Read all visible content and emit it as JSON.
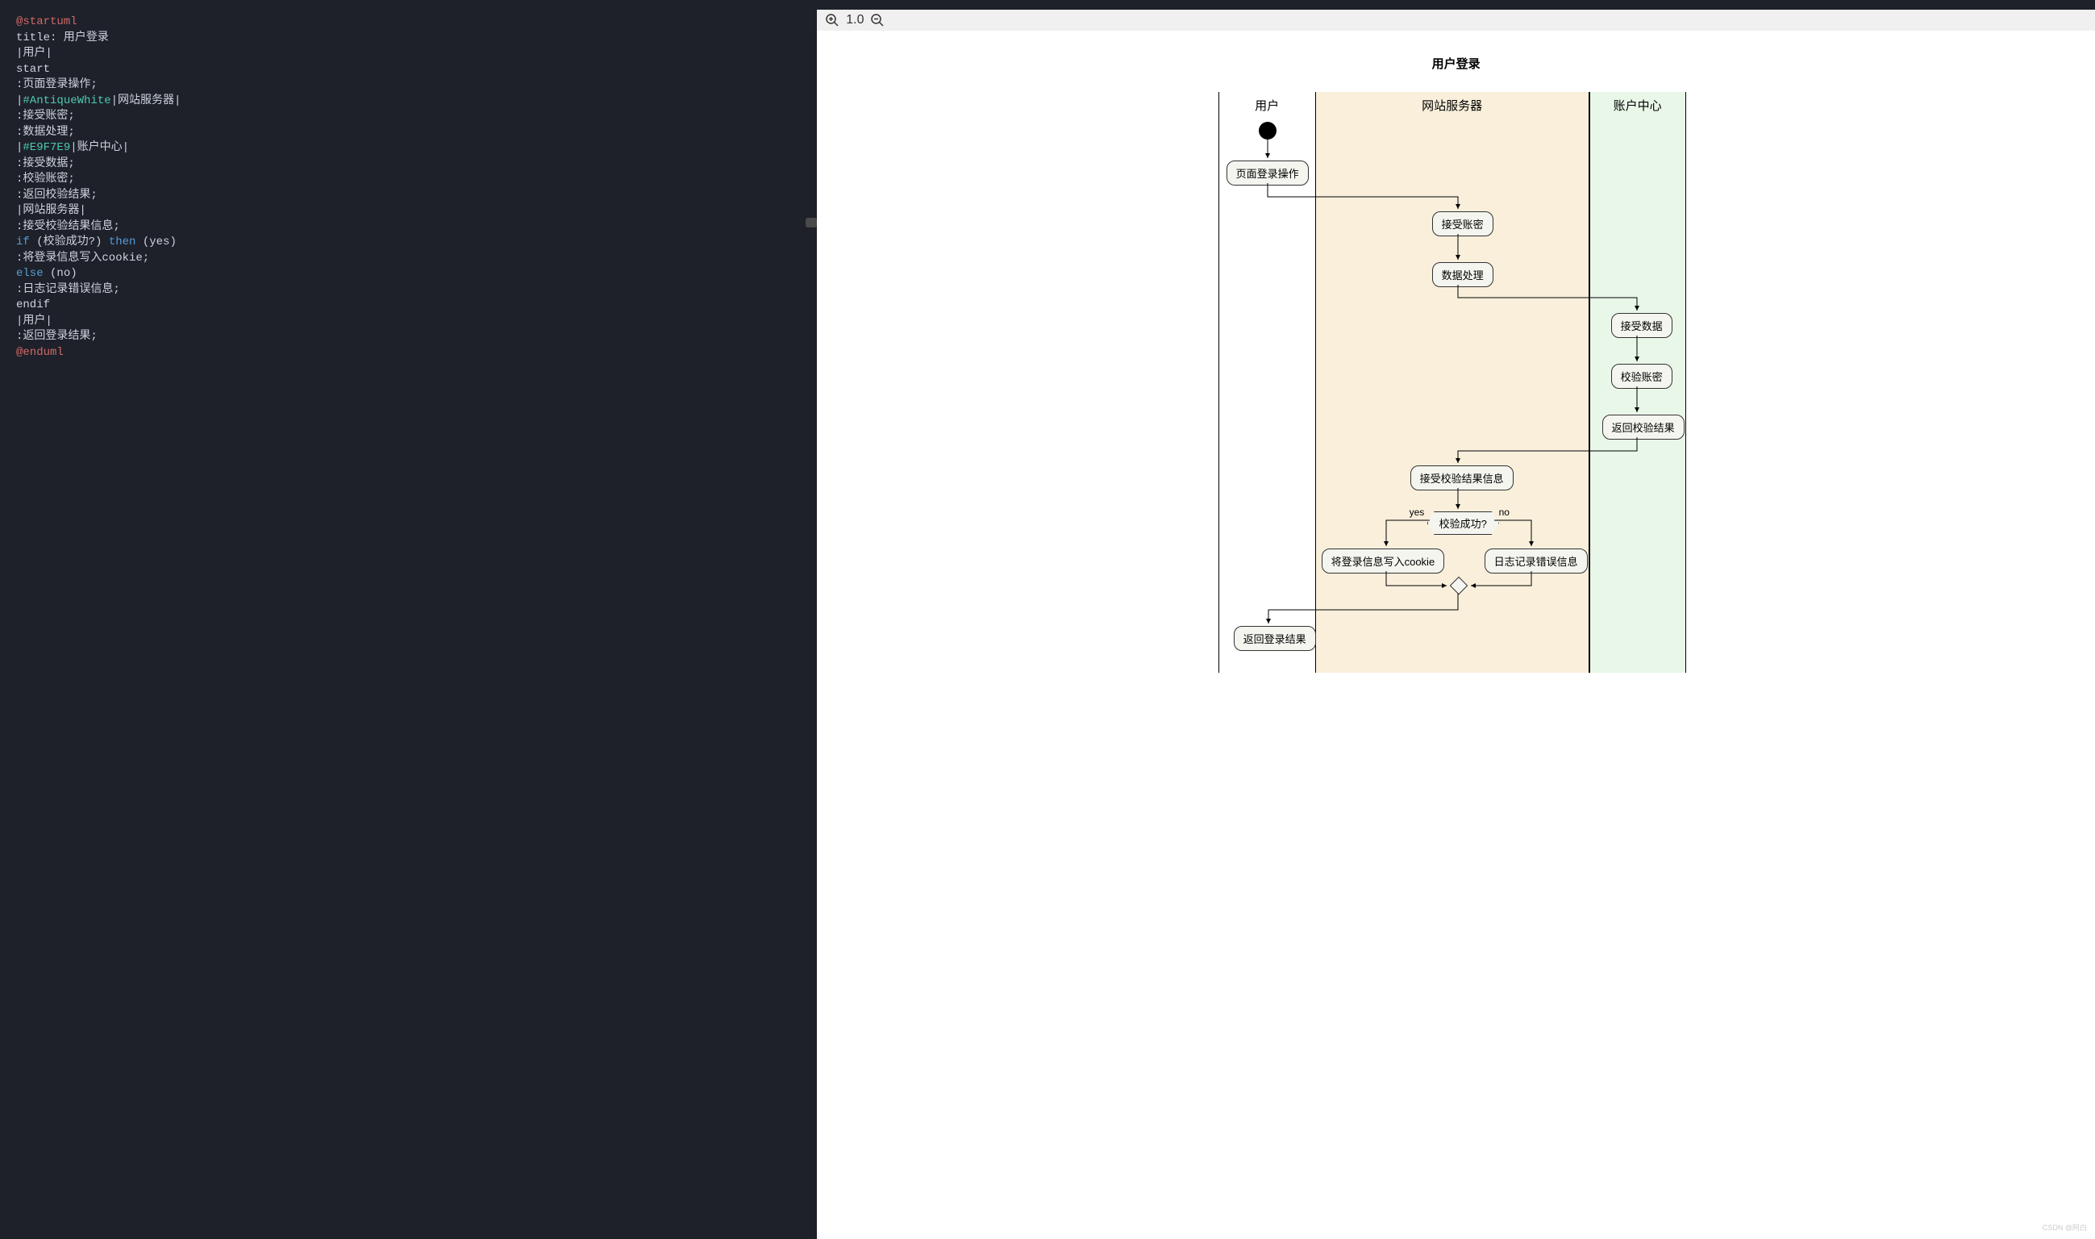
{
  "editor": {
    "lines": [
      {
        "tokens": [
          {
            "cls": "kw-red",
            "t": "@startuml"
          }
        ]
      },
      {
        "tokens": [
          {
            "cls": "txt",
            "t": "title: 用户登录"
          }
        ]
      },
      {
        "tokens": [
          {
            "cls": "txt",
            "t": "|用户|"
          }
        ]
      },
      {
        "tokens": [
          {
            "cls": "txt",
            "t": "start"
          }
        ]
      },
      {
        "tokens": [
          {
            "cls": "txt",
            "t": ":页面登录操作;"
          }
        ]
      },
      {
        "tokens": [
          {
            "cls": "txt",
            "t": "|"
          },
          {
            "cls": "kw-cyan",
            "t": "#AntiqueWhite"
          },
          {
            "cls": "txt",
            "t": "|网站服务器|"
          }
        ]
      },
      {
        "tokens": [
          {
            "cls": "txt",
            "t": ":接受账密;"
          }
        ]
      },
      {
        "tokens": [
          {
            "cls": "txt",
            "t": ":数据处理;"
          }
        ]
      },
      {
        "tokens": [
          {
            "cls": "txt",
            "t": "|"
          },
          {
            "cls": "kw-cyan",
            "t": "#E9F7E9"
          },
          {
            "cls": "txt",
            "t": "|账户中心|"
          }
        ]
      },
      {
        "tokens": [
          {
            "cls": "txt",
            "t": ":接受数据;"
          }
        ]
      },
      {
        "tokens": [
          {
            "cls": "txt",
            "t": ":校验账密;"
          }
        ]
      },
      {
        "tokens": [
          {
            "cls": "txt",
            "t": ":返回校验结果;"
          }
        ]
      },
      {
        "tokens": [
          {
            "cls": "txt",
            "t": "|网站服务器|"
          }
        ]
      },
      {
        "tokens": [
          {
            "cls": "txt",
            "t": ":接受校验结果信息;"
          }
        ]
      },
      {
        "tokens": [
          {
            "cls": "kw-blue",
            "t": "if"
          },
          {
            "cls": "txt",
            "t": " (校验成功?) "
          },
          {
            "cls": "kw-blue",
            "t": "then"
          },
          {
            "cls": "txt",
            "t": " (yes)"
          }
        ]
      },
      {
        "tokens": [
          {
            "cls": "txt",
            "t": ":将登录信息写入cookie;"
          }
        ]
      },
      {
        "tokens": [
          {
            "cls": "kw-blue",
            "t": "else"
          },
          {
            "cls": "txt",
            "t": " (no)"
          }
        ]
      },
      {
        "tokens": [
          {
            "cls": "txt",
            "t": ":日志记录错误信息;"
          }
        ]
      },
      {
        "tokens": [
          {
            "cls": "txt",
            "t": "endif"
          }
        ]
      },
      {
        "tokens": [
          {
            "cls": "txt",
            "t": "|用户|"
          }
        ]
      },
      {
        "tokens": [
          {
            "cls": "txt",
            "t": ":返回登录结果;"
          }
        ]
      },
      {
        "tokens": [
          {
            "cls": "kw-red",
            "t": "@enduml"
          }
        ]
      }
    ]
  },
  "zoom": {
    "value": "1.0"
  },
  "diagram": {
    "title": "用户登录",
    "lanes": {
      "user": "用户",
      "server": "网站服务器",
      "account": "账户中心"
    },
    "nodes": {
      "n1": "页面登录操作",
      "n2": "接受账密",
      "n3": "数据处理",
      "n4": "接受数据",
      "n5": "校验账密",
      "n6": "返回校验结果",
      "n7": "接受校验结果信息",
      "n8": "校验成功?",
      "yes": "yes",
      "no": "no",
      "n9": "将登录信息写入cookie",
      "n10": "日志记录错误信息",
      "n11": "返回登录结果"
    }
  },
  "watermark": "CSDN @阿白"
}
